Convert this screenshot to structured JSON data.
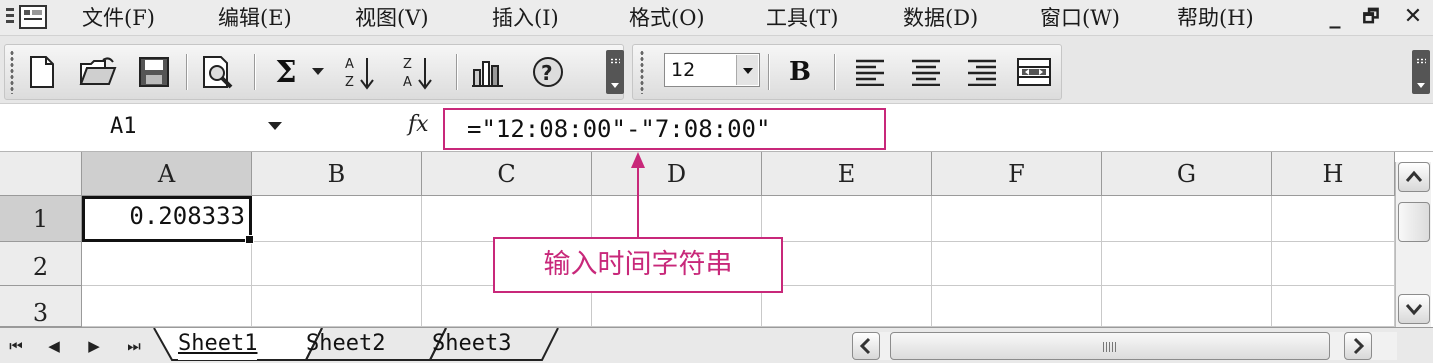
{
  "menu": {
    "items": [
      "文件(F)",
      "编辑(E)",
      "视图(V)",
      "插入(I)",
      "格式(O)",
      "工具(T)",
      "数据(D)",
      "窗口(W)",
      "帮助(H)"
    ],
    "window_controls": [
      "_",
      "🗗",
      "✕"
    ]
  },
  "toolbar": {
    "standard_icons": [
      "new-document-icon",
      "open-folder-icon",
      "save-icon",
      "print-preview-icon",
      "autosum-icon",
      "sort-ascending-icon",
      "sort-descending-icon",
      "chart-wizard-icon",
      "help-icon"
    ],
    "autosum_label": "Σ",
    "font_size": "12",
    "bold_label": "B",
    "format_icons": [
      "align-left-icon",
      "align-center-icon",
      "align-right-icon",
      "merge-center-icon"
    ]
  },
  "formula_bar": {
    "name_box": "A1",
    "fx_label": "fx",
    "formula": "=\"12:08:00\"-\"7:08:00\""
  },
  "grid": {
    "columns": [
      "A",
      "B",
      "C",
      "D",
      "E",
      "F",
      "G",
      "H"
    ],
    "rows": [
      "1",
      "2",
      "3"
    ],
    "active_cell": "A1",
    "cells": {
      "A1": "0.208333"
    }
  },
  "annotation": {
    "text": "输入时间字符串",
    "color": "#c8287a"
  },
  "sheets": {
    "tabs": [
      "Sheet1",
      "Sheet2",
      "Sheet3"
    ],
    "active": "Sheet1"
  }
}
